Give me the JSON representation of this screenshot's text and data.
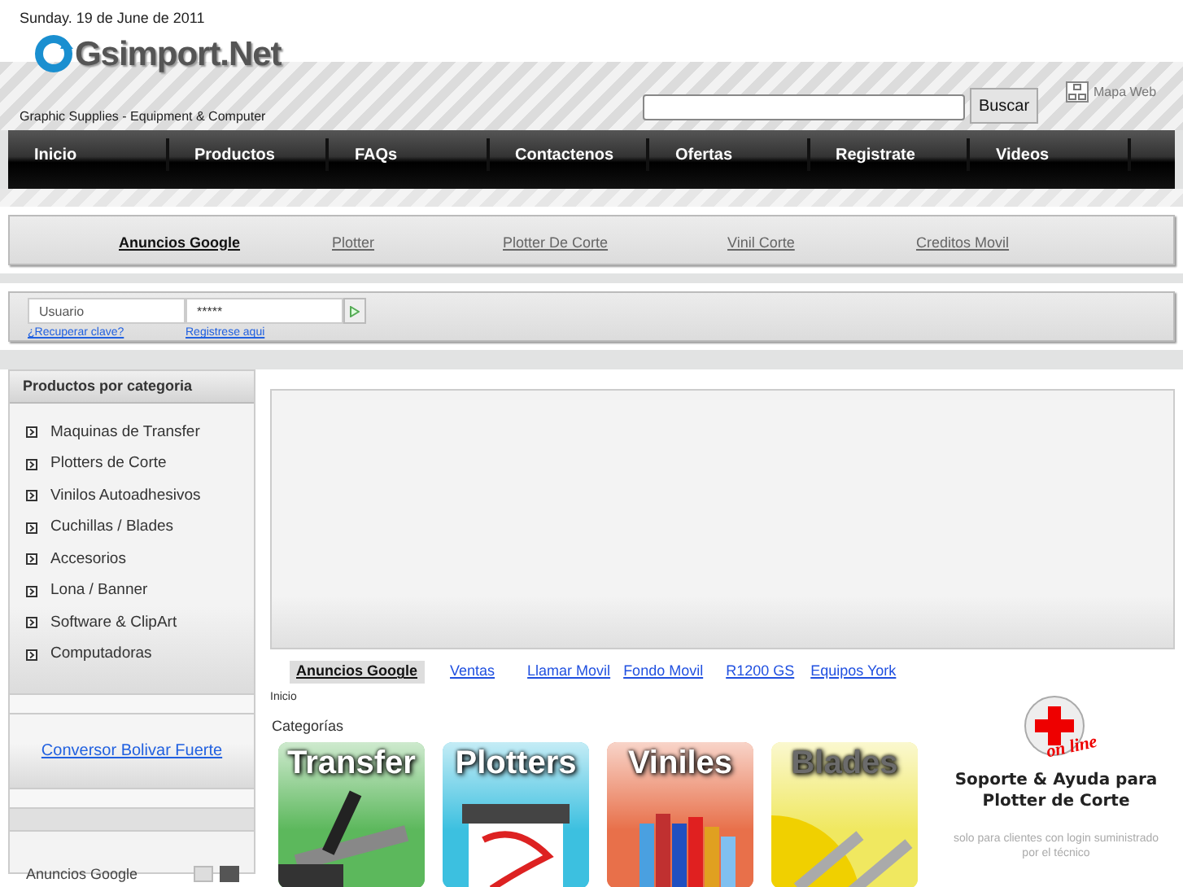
{
  "header": {
    "date": "Sunday. 19 de June de 2011",
    "logo_text": "Gsimport.Net",
    "tagline": "Graphic Supplies - Equipment & Computer",
    "search": {
      "button": "Buscar"
    },
    "site_map": "Mapa Web"
  },
  "nav": [
    "Inicio",
    "Productos",
    "FAQs",
    "Contactenos",
    "Ofertas",
    "Registrate",
    "Videos"
  ],
  "top_links": [
    {
      "label": "Anuncios Google",
      "kind": "heading"
    },
    {
      "label": "Plotter",
      "kind": "link"
    },
    {
      "label": "Plotter De Corte",
      "kind": "link"
    },
    {
      "label": "Vinil Corte",
      "kind": "link"
    },
    {
      "label": "Creditos Movil",
      "kind": "link"
    }
  ],
  "login": {
    "username_placeholder": "Usuario",
    "password_value": "*****",
    "links": [
      "¿Recuperar clave?",
      "Registrese aqui"
    ]
  },
  "sidebar": {
    "title": "Productos por categoria",
    "items": [
      "Maquinas de Transfer",
      "Plotters de Corte",
      "Vinilos Autoadhesivos",
      "Cuchillas / Blades",
      "Accesorios",
      "Lona / Banner",
      "Software & ClipArt",
      "Computadoras"
    ],
    "converter_link": "Conversor Bolivar Fuerte",
    "ad_label": "Anuncios Google"
  },
  "main_links": [
    {
      "label": "Anuncios Google",
      "kind": "heading"
    },
    {
      "label": "Ventas",
      "kind": "link"
    },
    {
      "label": "Llamar Movil",
      "kind": "link"
    },
    {
      "label": "Fondo Movil",
      "kind": "link"
    },
    {
      "label": "R1200 GS",
      "kind": "link"
    },
    {
      "label": "Equipos York",
      "kind": "link"
    }
  ],
  "breadcrumb": "Inicio",
  "categories_title": "Categorías",
  "categories": [
    {
      "title": "Transfer",
      "color": "#5cb85c"
    },
    {
      "title": "Plotters",
      "color": "#3cc0e0"
    },
    {
      "title": "Viniles",
      "color": "#e8704a"
    },
    {
      "title": "Blades",
      "color": "#f0e860"
    }
  ],
  "support": {
    "badge": "on line",
    "title": "Soporte & Ayuda para Plotter de Corte",
    "note": "solo para clientes con login suministrado por el técnico"
  }
}
